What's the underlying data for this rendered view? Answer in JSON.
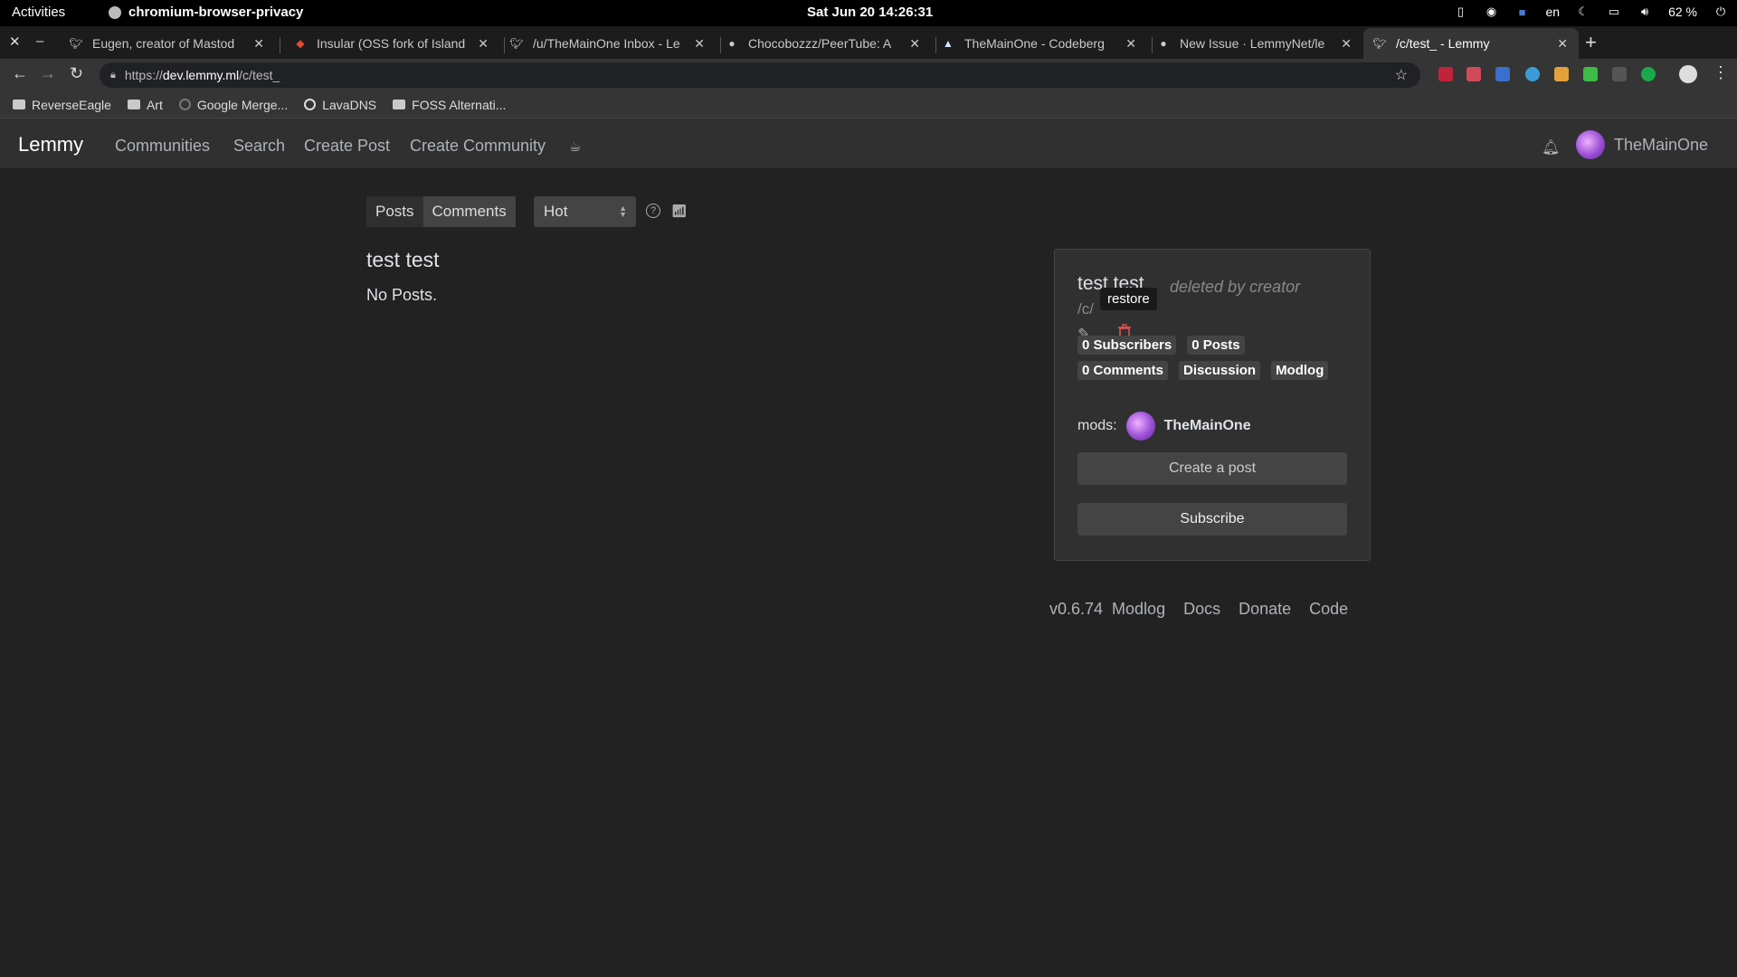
{
  "gnome": {
    "activities": "Activities",
    "app_name": "chromium-browser-privacy",
    "clock": "Sat Jun 20  14:26:31",
    "lang": "en",
    "battery": "62 %"
  },
  "tabs": [
    {
      "title": "Eugen, creator of Mastod",
      "icon": "mastodon-icon"
    },
    {
      "title": "Insular (OSS fork of Island",
      "icon": "gitlab-icon"
    },
    {
      "title": "/u/TheMainOne Inbox - Le",
      "icon": "lemmy-icon"
    },
    {
      "title": "Chocobozzz/PeerTube: A",
      "icon": "github-icon"
    },
    {
      "title": "TheMainOne - Codeberg",
      "icon": "codeberg-icon"
    },
    {
      "title": "New Issue · LemmyNet/le",
      "icon": "github-icon"
    },
    {
      "title": "/c/test_ - Lemmy",
      "icon": "lemmy-icon",
      "active": true
    }
  ],
  "address": {
    "scheme": "https://",
    "host": "dev.lemmy.ml",
    "path": "/c/test_"
  },
  "bookmarks": [
    {
      "label": "ReverseEagle",
      "icon": "folder-icon"
    },
    {
      "label": "Art",
      "icon": "folder-icon"
    },
    {
      "label": "Google Merge...",
      "icon": "github-icon"
    },
    {
      "label": "LavaDNS",
      "icon": "globe-icon"
    },
    {
      "label": "FOSS Alternati...",
      "icon": "folder-icon"
    }
  ],
  "navbar": {
    "brand": "Lemmy",
    "links": [
      "Communities",
      "Search",
      "Create Post",
      "Create Community"
    ],
    "username": "TheMainOne"
  },
  "listing": {
    "tabs": [
      "Posts",
      "Comments"
    ],
    "active_tab": "Comments",
    "sort": "Hot"
  },
  "main": {
    "title": "test test",
    "empty": "No Posts."
  },
  "sidebar": {
    "title": "test test",
    "status": "deleted by creator",
    "slug": "/c/",
    "tooltip": "restore",
    "subscribers": "0 Subscribers",
    "posts": "0 Posts",
    "comments": "0 Comments",
    "category": "Discussion",
    "modlog": "Modlog",
    "mods_label": "mods:",
    "mod_name": "TheMainOne",
    "create_post": "Create a post",
    "subscribe": "Subscribe"
  },
  "footer": {
    "version": "v0.6.74",
    "links": [
      "Modlog",
      "Docs",
      "Donate",
      "Code"
    ]
  },
  "colors": {
    "page_bg": "#222222",
    "navbar_bg": "#303030",
    "delete_red": "#e05252"
  }
}
